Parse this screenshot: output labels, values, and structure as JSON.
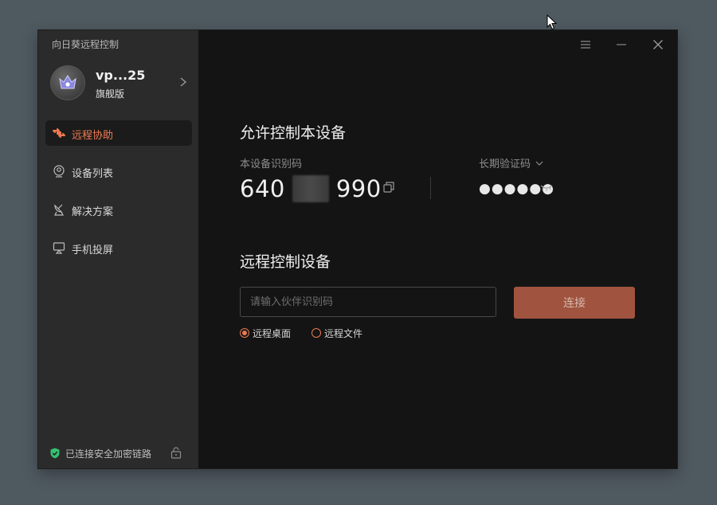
{
  "app": {
    "title": "向日葵远程控制"
  },
  "user": {
    "name": "vp...25",
    "tier": "旗舰版"
  },
  "nav": {
    "items": [
      {
        "label": "远程协助",
        "icon": "remote-assist-icon",
        "active": true
      },
      {
        "label": "设备列表",
        "icon": "device-list-icon",
        "active": false
      },
      {
        "label": "解决方案",
        "icon": "satellite-dish-icon",
        "active": false
      },
      {
        "label": "手机投屏",
        "icon": "screen-cast-icon",
        "active": false
      }
    ]
  },
  "footer": {
    "secure_text": "已连接安全加密链路"
  },
  "allow": {
    "title": "允许控制本设备",
    "device_id_label": "本设备识别码",
    "device_id_prefix": "640",
    "device_id_suffix": "990",
    "code_label": "长期验证码",
    "code_masked": "●●●●●●"
  },
  "remote": {
    "title": "远程控制设备",
    "input_placeholder": "请输入伙伴识别码",
    "connect_label": "连接",
    "modes": [
      {
        "label": "远程桌面",
        "selected": true
      },
      {
        "label": "远程文件",
        "selected": false
      }
    ]
  },
  "colors": {
    "accent": "#f07b52",
    "connect_button": "#a0543f",
    "secure_green": "#35c172",
    "sidebar_bg": "#2b2b2b",
    "main_bg": "#141414"
  }
}
